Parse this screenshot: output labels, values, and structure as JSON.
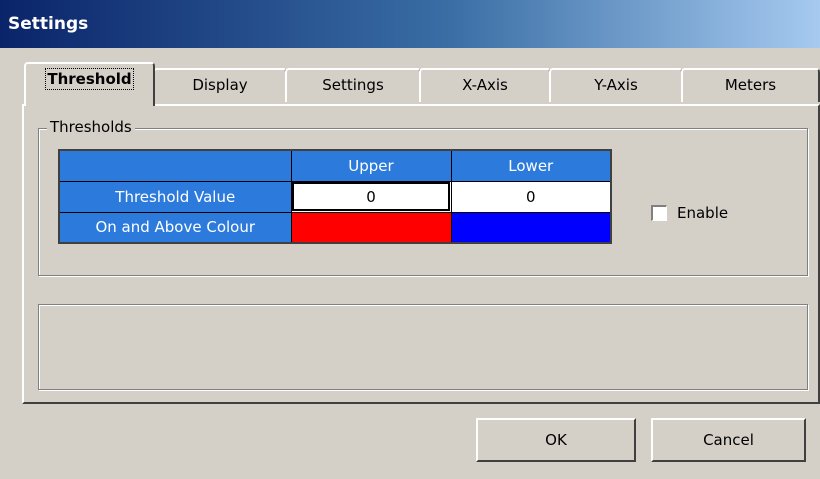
{
  "window": {
    "title": "Settings"
  },
  "tabs": [
    {
      "label": "Threshold",
      "active": true
    },
    {
      "label": "Display",
      "active": false
    },
    {
      "label": "Settings",
      "active": false
    },
    {
      "label": "X-Axis",
      "active": false
    },
    {
      "label": "Y-Axis",
      "active": false
    },
    {
      "label": "Meters",
      "active": false
    }
  ],
  "thresholds": {
    "group_label": "Thresholds",
    "columns": [
      "",
      "Upper",
      "Lower"
    ],
    "rows": [
      {
        "label": "Threshold Value",
        "upper": "0",
        "lower": "0"
      },
      {
        "label": "On and Above Colour",
        "upper_color": "#ff0000",
        "lower_color": "#0000ff"
      }
    ],
    "enable": {
      "label": "Enable",
      "checked": false
    }
  },
  "buttons": {
    "ok": "OK",
    "cancel": "Cancel"
  },
  "colors": {
    "title_gradient_start": "#0a246a",
    "grid_header": "#2c7bdc",
    "face": "#d4d0c8"
  }
}
